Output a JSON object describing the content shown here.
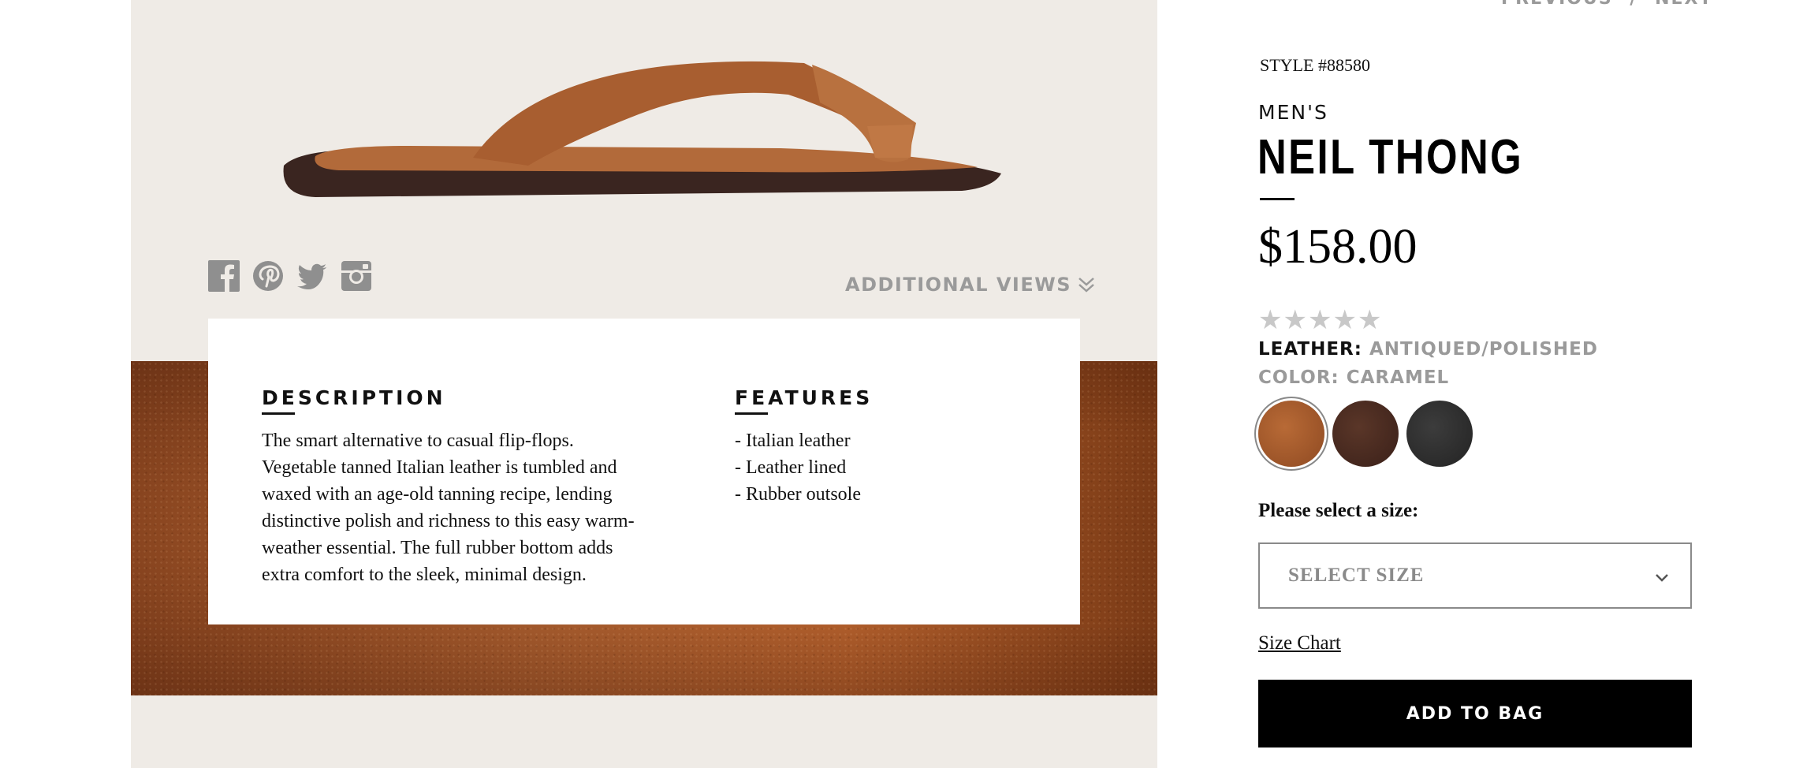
{
  "pager": {
    "previous": "PREVIOUS",
    "separator": "/",
    "next": "NEXT"
  },
  "product": {
    "style": "STYLE #88580",
    "gender": "MEN'S",
    "name": "NEIL THONG",
    "price": "$158.00",
    "rating": {
      "stars": 0,
      "max": 5
    },
    "leather": {
      "label": "LEATHER:",
      "value": "ANTIQUED/POLISHED"
    },
    "color": {
      "label": "COLOR:",
      "value": "CARAMEL"
    },
    "swatches": [
      {
        "color": "#a55a2b",
        "selected": true
      },
      {
        "color": "#4a2a20",
        "selected": false
      },
      {
        "color": "#2f2f2f",
        "selected": false
      }
    ]
  },
  "size": {
    "label": "Please select a size:",
    "placeholder": "SELECT SIZE",
    "chart_link": "Size Chart"
  },
  "actions": {
    "add_to_bag": "ADD TO BAG"
  },
  "media": {
    "additional_views": "ADDITIONAL VIEWS",
    "social": [
      "facebook-icon",
      "pinterest-icon",
      "twitter-icon",
      "instagram-icon"
    ]
  },
  "description": {
    "heading": "DESCRIPTION",
    "lines": [
      "The smart alternative to casual flip-flops.",
      "Vegetable tanned Italian leather is tumbled and",
      "waxed with an age-old tanning recipe, lending",
      "distinctive polish and richness to this easy warm-",
      "weather essential. The full rubber bottom adds",
      "extra comfort to the sleek, minimal design."
    ]
  },
  "features": {
    "heading": "FEATURES",
    "items": [
      "- Italian leather",
      "- Leather lined",
      "- Rubber outsole"
    ]
  },
  "colors": {
    "panel_bg": "#efebe6",
    "muted_text": "#9a9a9a",
    "button_bg": "#000000"
  }
}
